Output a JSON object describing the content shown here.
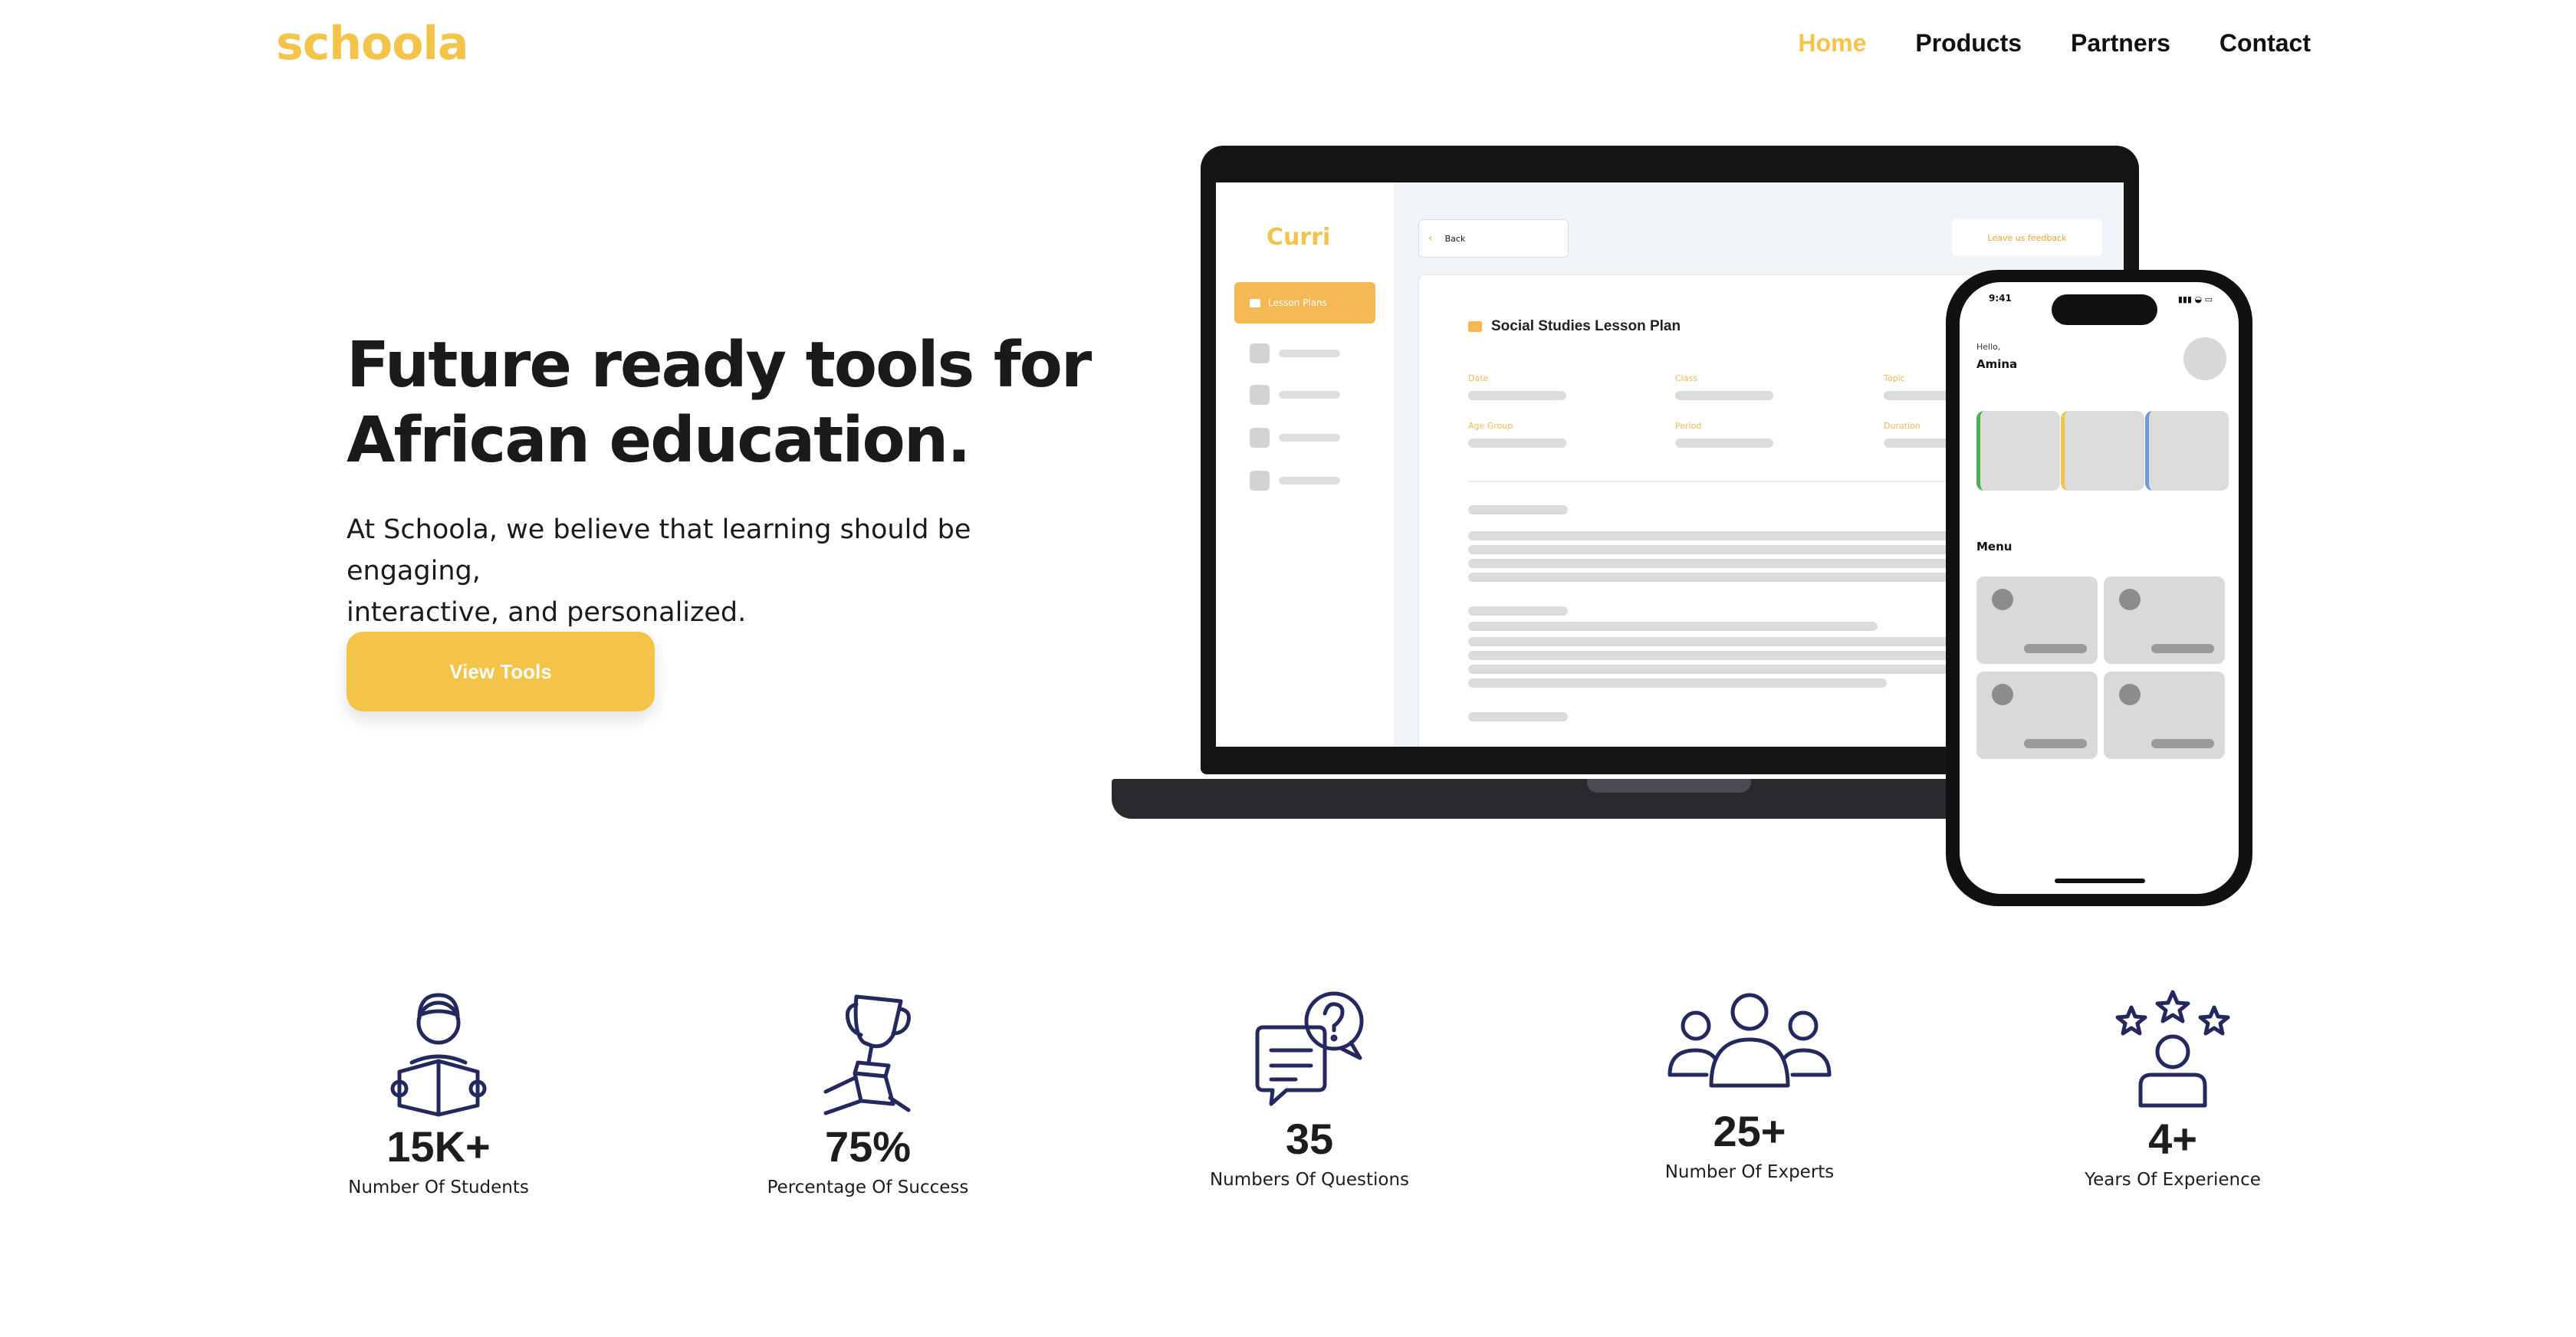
{
  "brand": {
    "logo": "schoola",
    "accent_color": "#f4c34a"
  },
  "nav": {
    "items": [
      {
        "label": "Home",
        "active": true
      },
      {
        "label": "Products",
        "active": false
      },
      {
        "label": "Partners",
        "active": false
      },
      {
        "label": "Contact",
        "active": false
      }
    ]
  },
  "hero": {
    "title_line1": "Future ready tools for",
    "title_line2": "African education.",
    "subtitle_line1": "At Schoola, we believe that learning should be engaging,",
    "subtitle_line2": "interactive, and personalized.",
    "cta_label": "View Tools"
  },
  "laptop_mockup": {
    "app_logo": "Curri",
    "sidebar_active": "Lesson Plans",
    "back_label": "Back",
    "feedback_label": "Leave us feedback",
    "plan_title": "Social Studies Lesson Plan",
    "fields": [
      "Date",
      "Class",
      "Topic",
      "Age Group",
      "Period",
      "Duration"
    ]
  },
  "phone_mockup": {
    "time": "9:41",
    "greeting": "Hello,",
    "name": "Amina",
    "menu_label": "Menu",
    "tile_accents": [
      "#4caf50",
      "#f4c34a",
      "#6b9bd8"
    ]
  },
  "stats": [
    {
      "value": "15K+",
      "label": "Number Of Students",
      "icon": "student-reading-icon"
    },
    {
      "value": "75%",
      "label": "Percentage Of Success",
      "icon": "trophy-hand-icon"
    },
    {
      "value": "35",
      "label": "Numbers Of Questions",
      "icon": "chat-question-icon"
    },
    {
      "value": "25+",
      "label": "Number Of Experts",
      "icon": "group-people-icon"
    },
    {
      "value": "4+",
      "label": "Years Of Experience",
      "icon": "person-stars-icon"
    }
  ]
}
